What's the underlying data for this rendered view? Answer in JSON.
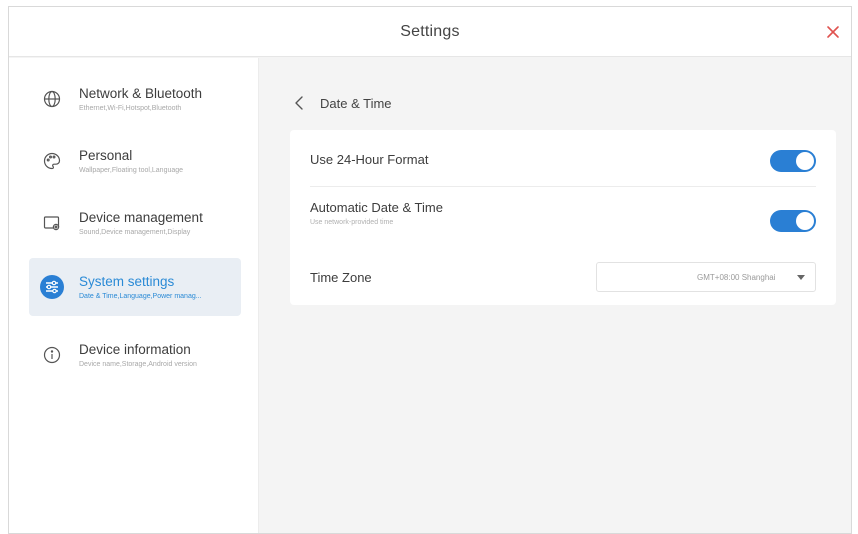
{
  "window": {
    "title": "Settings"
  },
  "sidebar": {
    "items": [
      {
        "label": "Network & Bluetooth",
        "sub": "Ethernet,Wi-Fi,Hotspot,Bluetooth",
        "icon": "globe-icon",
        "active": false
      },
      {
        "label": "Personal",
        "sub": "Wallpaper,Floating tool,Language",
        "icon": "palette-icon",
        "active": false
      },
      {
        "label": "Device management",
        "sub": "Sound,Device management,Display",
        "icon": "device-icon",
        "active": false
      },
      {
        "label": "System settings",
        "sub": "Date & Time,Language,Power manag...",
        "icon": "sliders-icon",
        "active": true
      },
      {
        "label": "Device information",
        "sub": "Device name,Storage,Android version",
        "icon": "info-icon",
        "active": false
      }
    ]
  },
  "content": {
    "title": "Date & Time",
    "rows": {
      "format24": {
        "label": "Use 24-Hour Format",
        "enabled": true
      },
      "auto": {
        "label": "Automatic Date & Time",
        "sub": "Use network-provided time",
        "enabled": true
      },
      "timezone": {
        "label": "Time Zone",
        "value": "GMT+08:00 Shanghai"
      }
    }
  },
  "colors": {
    "accent": "#2a7fd4",
    "close": "#e0524f",
    "active_bg": "#e9eef4"
  }
}
